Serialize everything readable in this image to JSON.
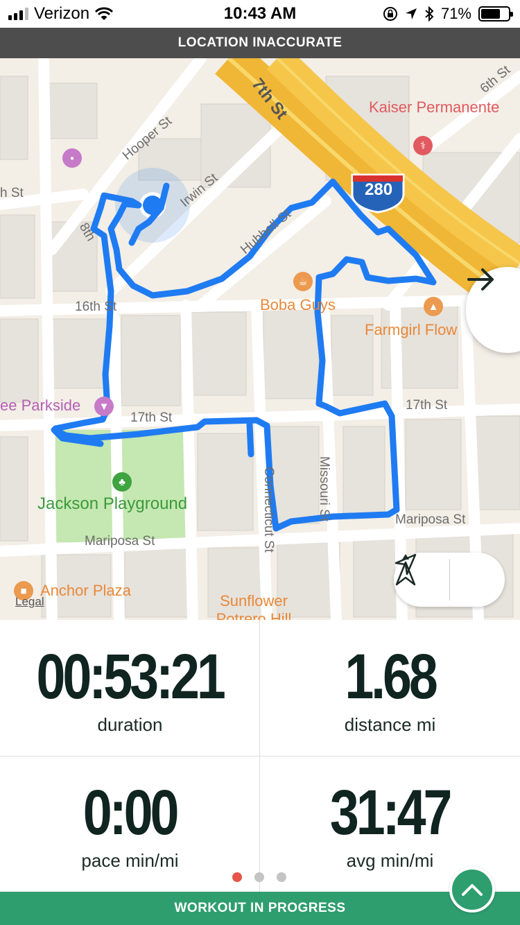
{
  "status_bar": {
    "carrier": "Verizon",
    "time": "10:43 AM",
    "battery_percent": "71%",
    "battery_level": 0.71
  },
  "location_banner": "LOCATION INACCURATE",
  "map": {
    "streets": {
      "hooper": "Hooper St",
      "seventh": "7th St",
      "irwin": "Irwin St",
      "hubbell": "Hubbell St",
      "h": "h St",
      "eighth": "8th",
      "sixteenth": "16th St",
      "seventeenth_left": "17th St",
      "seventeenth_right": "17th St",
      "missouri": "Missouri St",
      "connecticut": "Connecticut St",
      "mariposa_left": "Mariposa St",
      "mariposa_right": "Mariposa St",
      "sixth": "6th St"
    },
    "highway_shield": "280",
    "pois": {
      "kaiser": "Kaiser Permanente",
      "boba": "Boba Guys",
      "farmgirl": "Farmgirl Flow",
      "parkside": "ee Parkside",
      "jackson": "Jackson Playground",
      "anchor": "Anchor Plaza",
      "sunflower": "Sunflower Potrero Hill"
    },
    "legal": "Legal"
  },
  "stats": {
    "duration": {
      "value": "00:53:21",
      "label": "duration"
    },
    "distance": {
      "value": "1.68",
      "label": "distance mi"
    },
    "pace": {
      "value": "0:00",
      "label": "pace min/mi"
    },
    "avg": {
      "value": "31:47",
      "label": "avg min/mi"
    }
  },
  "pager": {
    "pages": 3,
    "active": 1
  },
  "workout_banner": "WORKOUT IN PROGRESS",
  "colors": {
    "route": "#1f7bf2",
    "banner_dark": "#4d4d4d",
    "banner_green": "#2f9e6f",
    "pager_active": "#e85548",
    "highway": "#f6c64a"
  },
  "icons": [
    "wifi-icon",
    "lock-rotation-icon",
    "location-arrow-icon",
    "bluetooth-icon",
    "arrow-right-icon",
    "navigate-icon",
    "compass-icon",
    "chevron-up-icon"
  ]
}
